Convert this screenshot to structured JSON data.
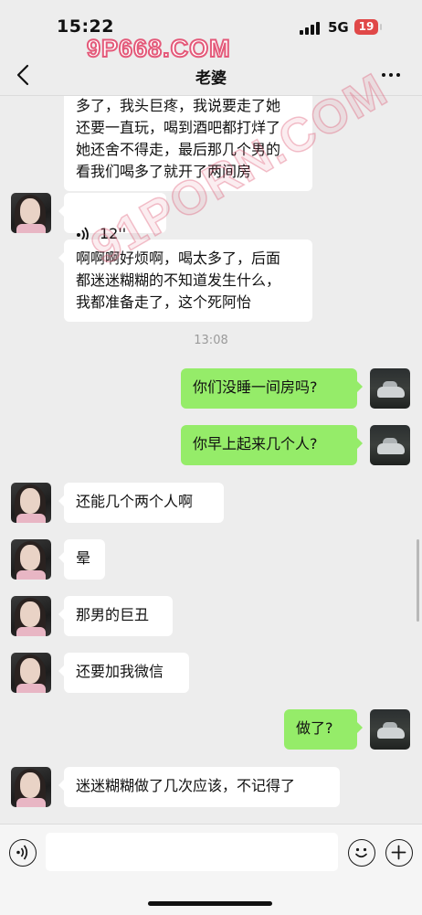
{
  "status_bar": {
    "time": "15:22",
    "network": "5G",
    "battery": "19"
  },
  "watermark": {
    "top": "9P668.COM",
    "diagonal": "91PORN.COM"
  },
  "nav": {
    "title": "老婆",
    "back_icon": "chevron-left-icon",
    "more_icon": "ellipsis-icon"
  },
  "messages": [
    {
      "sender": "wife",
      "type": "text",
      "text": "多了，我头巨疼，我说要走了她\n还要一直玩，喝到酒吧都打烊了\n她还舍不得走，最后那几个男的\n看我们喝多了就开了两间房"
    },
    {
      "sender": "wife",
      "type": "voice",
      "duration": "12''"
    },
    {
      "sender": "wife",
      "type": "text",
      "text": "啊啊啊好烦啊，喝太多了，后面\n都迷迷糊糊的不知道发生什么，\n我都准备走了，这个死阿怡"
    },
    {
      "type": "timestamp",
      "text": "13:08"
    },
    {
      "sender": "me",
      "type": "text",
      "text": "你们没睡一间房吗?"
    },
    {
      "sender": "me",
      "type": "text",
      "text": "你早上起来几个人?"
    },
    {
      "sender": "wife",
      "type": "text",
      "text": "还能几个两个人啊"
    },
    {
      "sender": "wife",
      "type": "text",
      "text": "晕"
    },
    {
      "sender": "wife",
      "type": "text",
      "text": "那男的巨丑"
    },
    {
      "sender": "wife",
      "type": "text",
      "text": "还要加我微信"
    },
    {
      "sender": "me",
      "type": "text",
      "text": "做了?"
    },
    {
      "sender": "wife",
      "type": "text",
      "text": "迷迷糊糊做了几次应该，不记得了"
    }
  ],
  "input_bar": {
    "voice_icon": "voice-input-icon",
    "input_value": "",
    "emoji_icon": "smiley-icon",
    "plus_icon": "plus-icon"
  },
  "colors": {
    "background": "#ededed",
    "incoming_bubble": "#ffffff",
    "outgoing_bubble": "#95ec69",
    "battery": "#e04848"
  }
}
